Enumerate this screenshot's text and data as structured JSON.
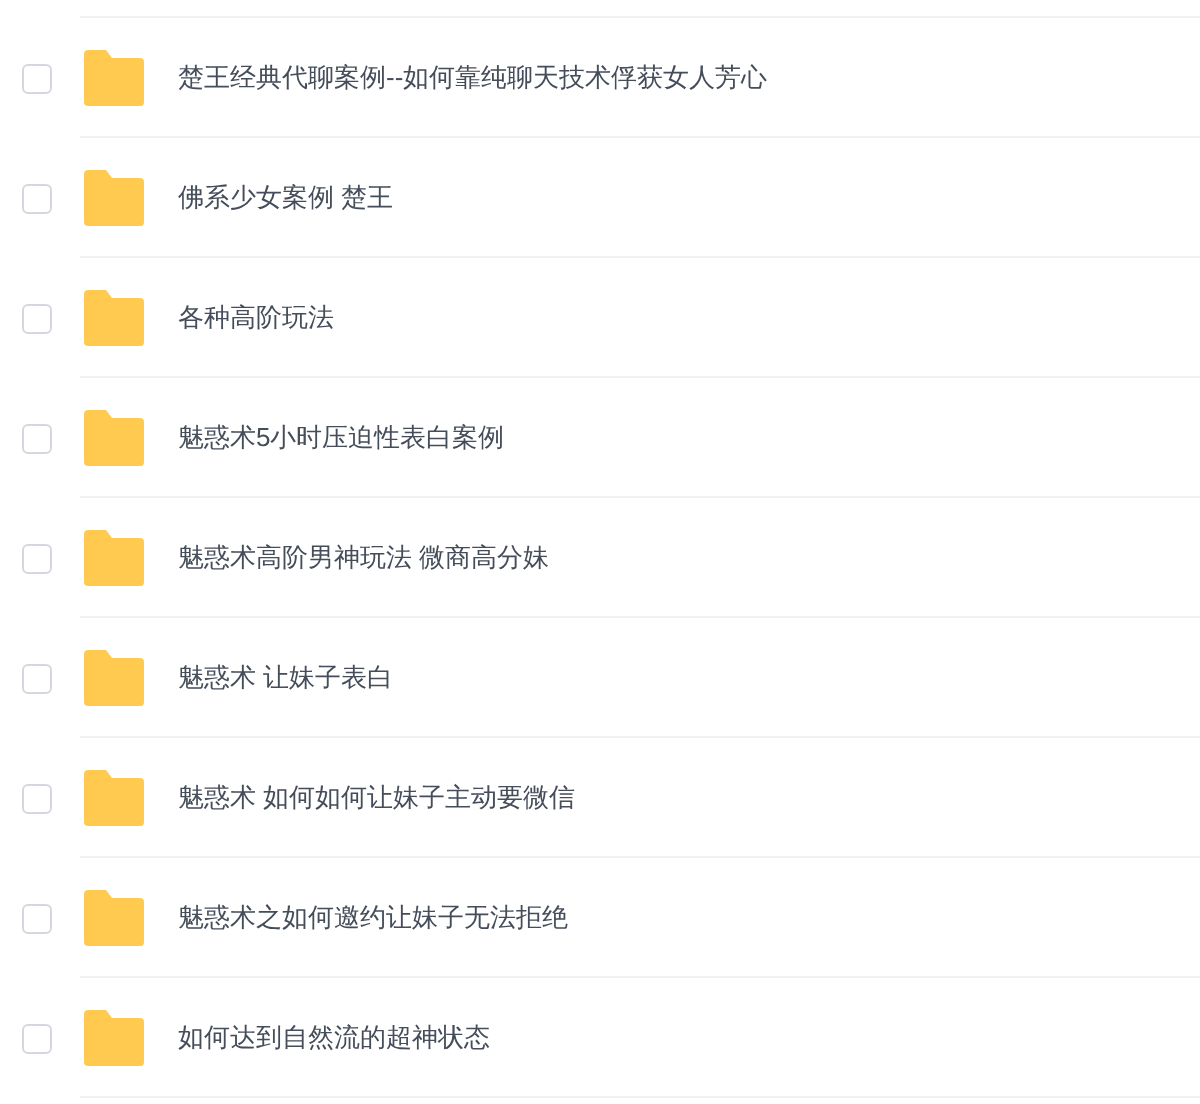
{
  "files": [
    {
      "name": "楚王经典代聊案例--如何靠纯聊天技术俘获女人芳心",
      "checked": false
    },
    {
      "name": "佛系少女案例 楚王",
      "checked": false
    },
    {
      "name": "各种高阶玩法",
      "checked": false
    },
    {
      "name": "魅惑术5小时压迫性表白案例",
      "checked": false
    },
    {
      "name": "魅惑术高阶男神玩法 微商高分妹",
      "checked": false
    },
    {
      "name": "魅惑术 让妹子表白",
      "checked": false
    },
    {
      "name": "魅惑术 如何如何让妹子主动要微信",
      "checked": false
    },
    {
      "name": "魅惑术之如何邀约让妹子无法拒绝",
      "checked": false
    },
    {
      "name": "如何达到自然流的超神状态",
      "checked": false
    }
  ]
}
